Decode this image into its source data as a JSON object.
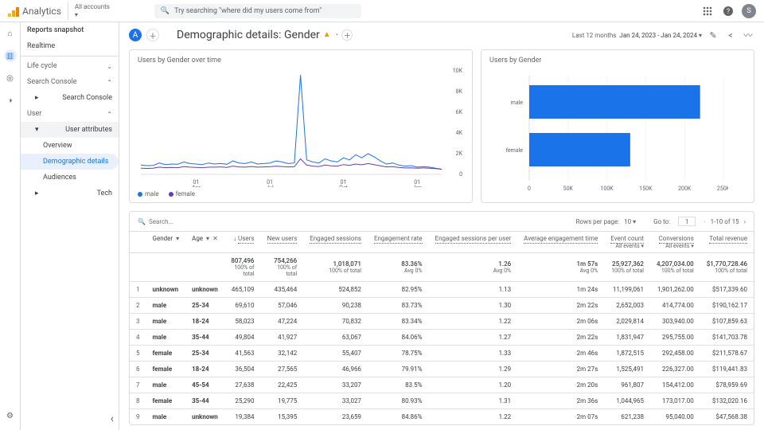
{
  "app": {
    "name": "Analytics"
  },
  "account_selector": {
    "label": "All accounts"
  },
  "search": {
    "placeholder": "Try searching \"where did my users come from\""
  },
  "avatar": {
    "initial": "S"
  },
  "sidebar": {
    "snapshot": "Reports snapshot",
    "realtime": "Realtime",
    "groups": {
      "lifecycle": "Life cycle",
      "search_console": "Search Console",
      "search_console_sub": "Search Console",
      "user": "User",
      "user_attributes": "User attributes",
      "overview": "Overview",
      "demographic": "Demographic details",
      "audiences": "Audiences",
      "tech": "Tech"
    }
  },
  "header": {
    "title": "Demographic details: Gender",
    "date_label": "Last 12 months",
    "date_range": "Jan 24, 2023 - Jan 24, 2024"
  },
  "chart_data": [
    {
      "type": "line",
      "title": "Users by Gender over time",
      "xlabel": "",
      "ylabel": "",
      "x_ticks": [
        "01 Apr",
        "01 Jul",
        "01 Oct",
        "01 Jan"
      ],
      "ylim": [
        0,
        10000
      ],
      "y_ticks": [
        0,
        2000,
        4000,
        6000,
        8000,
        10000
      ],
      "y_tick_labels": [
        "0",
        "2K",
        "4K",
        "6K",
        "8K",
        "10K"
      ],
      "series": [
        {
          "name": "male",
          "color": "#1a73e8",
          "values": [
            900,
            850,
            870,
            1100,
            950,
            1000,
            980,
            1200,
            1050,
            1000,
            950,
            1100,
            1000,
            1050,
            980,
            1300,
            1100,
            1050,
            1200,
            1000,
            1050,
            1100,
            1300,
            1200,
            1050,
            1100,
            9600,
            1400,
            1200,
            1100,
            1500,
            1300,
            1200,
            1600,
            1400,
            1900,
            1600,
            2000,
            1700,
            1300,
            1000,
            1100,
            900,
            800,
            850,
            700,
            750,
            700,
            600,
            500
          ]
        },
        {
          "name": "female",
          "color": "#673ab7",
          "values": [
            600,
            580,
            600,
            700,
            650,
            680,
            650,
            750,
            700,
            680,
            650,
            700,
            700,
            720,
            680,
            800,
            720,
            700,
            760,
            700,
            720,
            740,
            800,
            760,
            720,
            740,
            1500,
            900,
            800,
            760,
            900,
            820,
            800,
            950,
            880,
            1000,
            920,
            1050,
            950,
            820,
            720,
            750,
            680,
            620,
            640,
            600,
            620,
            600,
            560,
            500
          ]
        }
      ],
      "legend": [
        "male",
        "female"
      ]
    },
    {
      "type": "bar",
      "orientation": "horizontal",
      "title": "Users by Gender",
      "categories": [
        "male",
        "female"
      ],
      "values": [
        220000,
        130000
      ],
      "color": "#1a73e8",
      "xlim": [
        0,
        250000
      ],
      "x_ticks": [
        0,
        50000,
        100000,
        150000,
        200000,
        250000
      ],
      "x_tick_labels": [
        "0",
        "50K",
        "100K",
        "150K",
        "200K",
        "250K"
      ]
    }
  ],
  "table_toolbar": {
    "search_placeholder": "Search...",
    "rows_per_page_label": "Rows per page:",
    "rows_per_page_value": "10",
    "goto_label": "Go to:",
    "goto_value": "1",
    "range": "1-10 of 15"
  },
  "table": {
    "dim1": {
      "label": "Gender"
    },
    "dim2": {
      "label": "Age"
    },
    "metrics": [
      {
        "name": "Users",
        "sort_desc": true
      },
      {
        "name": "New users"
      },
      {
        "name": "Engaged sessions"
      },
      {
        "name": "Engagement rate"
      },
      {
        "name": "Engaged sessions per user"
      },
      {
        "name": "Average engagement time"
      },
      {
        "name": "Event count",
        "sub": "All events"
      },
      {
        "name": "Conversions",
        "sub": "All events"
      },
      {
        "name": "Total revenue"
      }
    ],
    "totals": {
      "values": [
        "807,496",
        "754,266",
        "1,018,071",
        "83.36%",
        "1.26",
        "1m 57s",
        "25,927,362",
        "4,207,034.00",
        "$1,770,728.46"
      ],
      "subs": [
        "100% of total",
        "100% of total",
        "100% of total",
        "Avg 0%",
        "Avg 0%",
        "Avg 0%",
        "100% of total",
        "100% of total",
        "100% of total"
      ]
    },
    "rows": [
      {
        "i": 1,
        "gender": "unknown",
        "age": "unknown",
        "v": [
          "465,109",
          "435,464",
          "524,852",
          "82.95%",
          "1.13",
          "1m 24s",
          "11,199,061",
          "1,901,262.00",
          "$517,339.60"
        ]
      },
      {
        "i": 2,
        "gender": "male",
        "age": "25-34",
        "v": [
          "69,610",
          "57,046",
          "90,238",
          "83.73%",
          "1.30",
          "2m 22s",
          "2,652,003",
          "414,774.00",
          "$190,162.17"
        ]
      },
      {
        "i": 3,
        "gender": "male",
        "age": "18-24",
        "v": [
          "58,023",
          "47,224",
          "70,832",
          "83.34%",
          "1.22",
          "2m 06s",
          "2,029,814",
          "303,940.00",
          "$107,859.63"
        ]
      },
      {
        "i": 4,
        "gender": "male",
        "age": "35-44",
        "v": [
          "49,804",
          "41,927",
          "63,067",
          "84.06%",
          "1.27",
          "2m 22s",
          "1,831,947",
          "295,755.00",
          "$141,703.78"
        ]
      },
      {
        "i": 5,
        "gender": "female",
        "age": "25-34",
        "v": [
          "41,563",
          "32,142",
          "55,407",
          "78.75%",
          "1.33",
          "2m 46s",
          "1,872,515",
          "292,458.00",
          "$211,578.67"
        ]
      },
      {
        "i": 6,
        "gender": "female",
        "age": "18-24",
        "v": [
          "36,504",
          "27,565",
          "46,966",
          "79.91%",
          "1.29",
          "2m 27s",
          "1,525,491",
          "226,327.00",
          "$119,441.83"
        ]
      },
      {
        "i": 7,
        "gender": "male",
        "age": "45-54",
        "v": [
          "27,638",
          "22,425",
          "33,207",
          "83.5%",
          "1.20",
          "2m 20s",
          "961,807",
          "154,412.00",
          "$78,959.69"
        ]
      },
      {
        "i": 8,
        "gender": "female",
        "age": "35-44",
        "v": [
          "25,290",
          "19,775",
          "33,027",
          "80.93%",
          "1.31",
          "2m 36s",
          "1,044,965",
          "173,017.00",
          "$132,020.16"
        ]
      },
      {
        "i": 9,
        "gender": "male",
        "age": "unknown",
        "v": [
          "19,384",
          "15,395",
          "23,659",
          "84.86%",
          "1.22",
          "2m 07s",
          "621,238",
          "95,040.00",
          "$47,568.38"
        ]
      }
    ]
  }
}
